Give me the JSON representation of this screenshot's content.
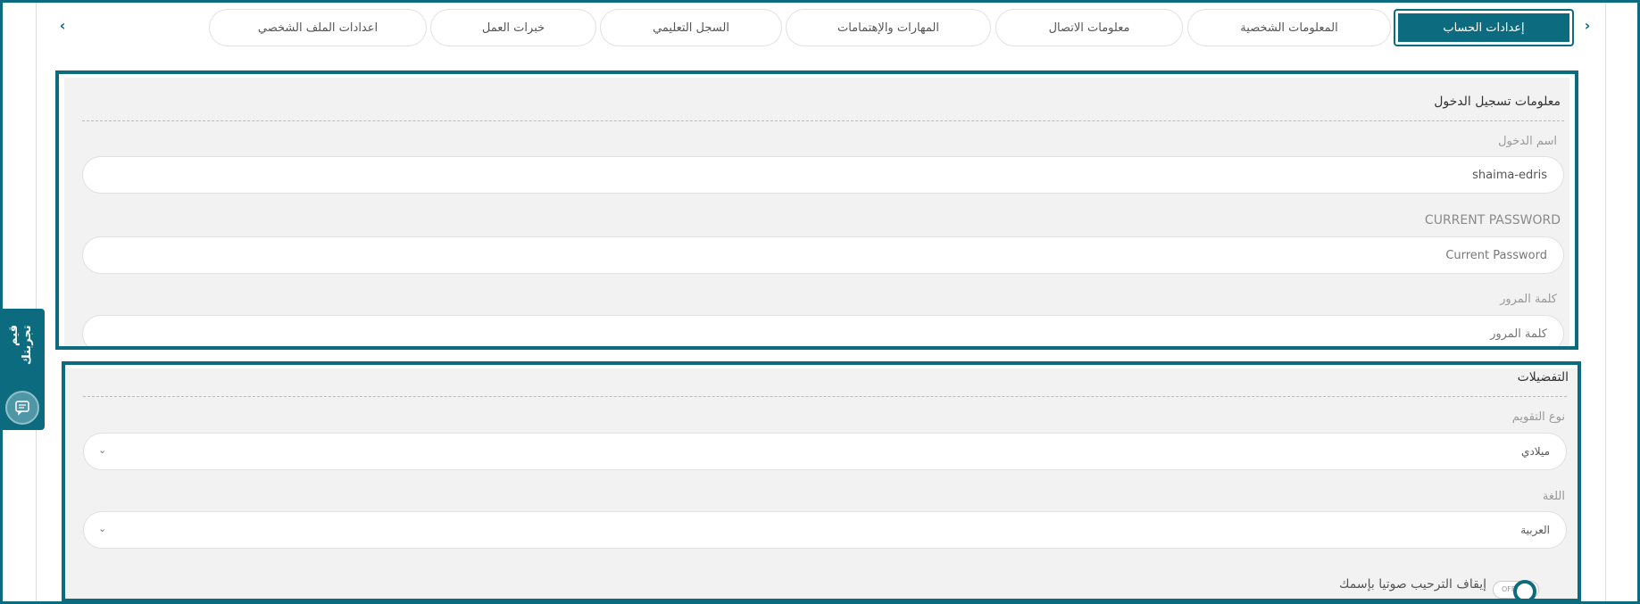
{
  "tabs": {
    "items": [
      {
        "label": "إعدادات الحساب",
        "active": true
      },
      {
        "label": "المعلومات الشخصية",
        "active": false
      },
      {
        "label": "معلومات الاتصال",
        "active": false
      },
      {
        "label": "المهارات والإهتمامات",
        "active": false
      },
      {
        "label": "السجل التعليمي",
        "active": false
      },
      {
        "label": "خبرات العمل",
        "active": false
      },
      {
        "label": "اعدادات الملف الشخصي",
        "active": false
      }
    ],
    "prev_icon": "chevron-right-icon",
    "next_icon": "chevron-left-icon"
  },
  "login_section": {
    "title": "معلومات تسجيل الدخول",
    "username": {
      "label": "اسم الدخول",
      "value": "shaima-edris"
    },
    "current_password": {
      "label": "CURRENT PASSWORD",
      "placeholder": "Current Password"
    },
    "password": {
      "label": "كلمة المرور",
      "placeholder": "كلمة المرور"
    }
  },
  "preferences_section": {
    "title": "التفضيلات",
    "calendar": {
      "label": "نوع التقويم",
      "value": "ميلادي"
    },
    "language": {
      "label": "اللغة",
      "value": "العربية"
    },
    "voice_greeting": {
      "label": "إيقاف الترحيب صوتيا بإسمك",
      "toggle_text": "OFF",
      "enabled": false
    }
  },
  "feedback": {
    "label": "قيم تجربتك",
    "icon": "feedback-chat-icon"
  },
  "colors": {
    "accent": "#0d6b80",
    "panel": "#f2f2f2"
  }
}
